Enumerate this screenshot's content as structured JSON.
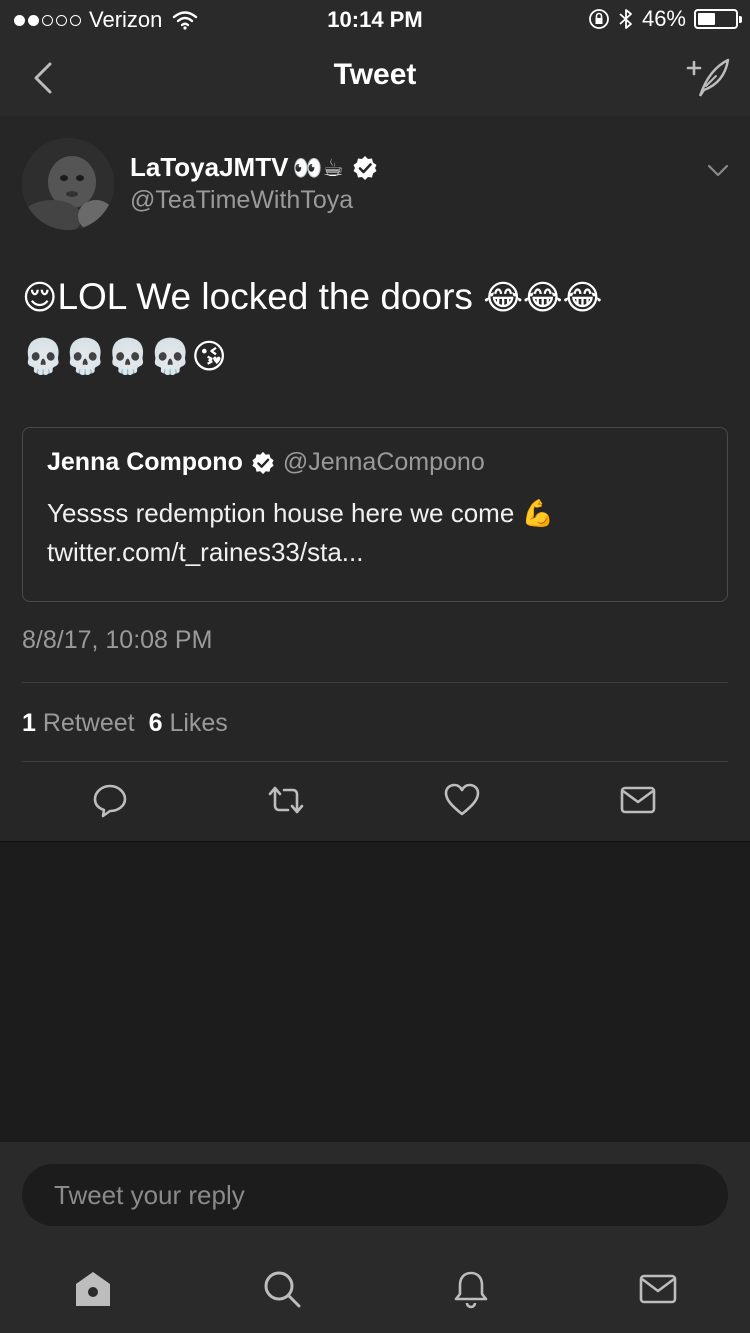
{
  "status_bar": {
    "carrier": "Verizon",
    "time": "10:14 PM",
    "battery": "46%",
    "battery_level": 0.46
  },
  "nav": {
    "title": "Tweet",
    "back_icon": "chevron-left-icon",
    "compose_icon": "compose-tweet-icon"
  },
  "tweet": {
    "author_name": "LaToyaJMTV",
    "author_emoji": "👀☕",
    "author_handle": "@TeaTimeWithToya",
    "verified": true,
    "text_line1_emoji": "😌",
    "text_line1": "LOL We locked the doors",
    "text_line1_trailing_emoji": "😂😂😂",
    "text_line2_emoji": "💀💀💀💀😘",
    "timestamp": "8/8/17, 10:08 PM",
    "retweet_count": "1",
    "retweet_label": "Retweet",
    "like_count": "6",
    "like_label": "Likes"
  },
  "quoted_tweet": {
    "author_name": "Jenna Compono",
    "verified": true,
    "author_handle": "@JennaCompono",
    "text": "Yessss redemption house here we come",
    "text_emoji": "💪",
    "link": "twitter.com/t_raines33/sta..."
  },
  "actions": [
    "reply-icon",
    "retweet-icon",
    "like-icon",
    "direct-message-icon"
  ],
  "reply": {
    "placeholder": "Tweet your reply"
  },
  "tabs": [
    "home-icon",
    "search-icon",
    "notifications-icon",
    "messages-icon"
  ],
  "colors": {
    "background": "#1c1c1c",
    "card": "#262626",
    "bar": "#2a2a2a",
    "secondary_text": "#9a9a9a"
  }
}
